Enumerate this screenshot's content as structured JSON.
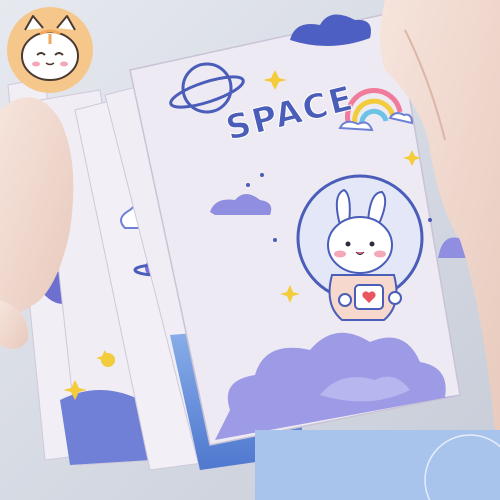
{
  "cover": {
    "title": "SPACE"
  },
  "colors": {
    "background": "#d9dde6",
    "cover": "#eeeaf3",
    "accent_blue": "#4a5db8",
    "cloud_purple": "#8f8ee0",
    "star_yellow": "#f3cc3c",
    "badge_orange": "#f6c78b"
  },
  "icons": {
    "badge": "cat-face-icon",
    "planet": "ringed-planet-icon",
    "rainbow": "rainbow-icon",
    "mascot": "bunny-astronaut-icon"
  }
}
